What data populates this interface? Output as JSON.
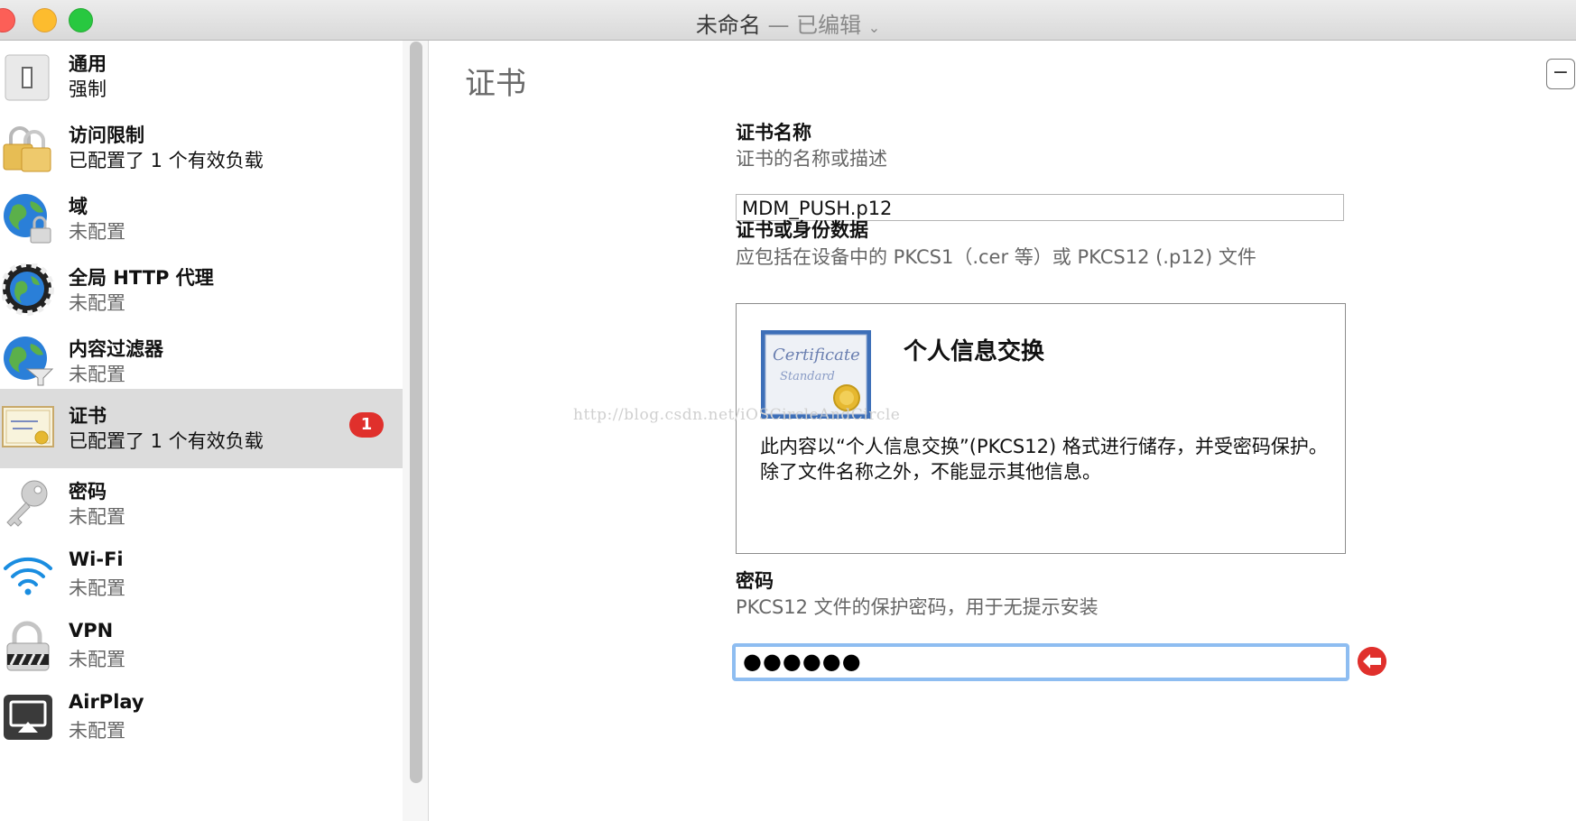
{
  "window": {
    "title": "未命名",
    "subtitle": "— 已编辑"
  },
  "sidebar": {
    "items": [
      {
        "label": "通用",
        "status": "强制",
        "icon": "switch-icon",
        "configured": true
      },
      {
        "label": "访问限制",
        "status": "已配置了 1 个有效负载",
        "icon": "padlocks-icon",
        "configured": true
      },
      {
        "label": "域",
        "status": "未配置",
        "icon": "globe-lock-icon",
        "configured": false
      },
      {
        "label": "全局 HTTP 代理",
        "status": "未配置",
        "icon": "globe-proxy-icon",
        "configured": false
      },
      {
        "label": "内容过滤器",
        "status": "未配置",
        "icon": "globe-filter-icon",
        "configured": false
      },
      {
        "label": "证书",
        "status": "已配置了 1 个有效负载",
        "icon": "certificate-icon",
        "configured": true,
        "selected": true,
        "badge": "1"
      },
      {
        "label": "密码",
        "status": "未配置",
        "icon": "key-icon",
        "configured": false
      },
      {
        "label": "Wi-Fi",
        "status": "未配置",
        "icon": "wifi-icon",
        "configured": false
      },
      {
        "label": "VPN",
        "status": "未配置",
        "icon": "vpn-lock-icon",
        "configured": false
      },
      {
        "label": "AirPlay",
        "status": "未配置",
        "icon": "airplay-icon",
        "configured": false
      }
    ]
  },
  "main": {
    "title": "证书",
    "remove_label": "−",
    "cert_name": {
      "label": "证书名称",
      "description": "证书的名称或描述",
      "value": "MDM_PUSH.p12"
    },
    "cert_data": {
      "label": "证书或身份数据",
      "description": "应包括在设备中的 PKCS1（.cer 等）或 PKCS12 (.p12) 文件",
      "card_title": "个人信息交换",
      "card_description": "此内容以“个人信息交换”(PKCS12) 格式进行储存，并受密码保护。除了文件名称之外，不能显示其他信息。",
      "image_text_1": "Certificate",
      "image_text_2": "Standard"
    },
    "password": {
      "label": "密码",
      "description": "PKCS12 文件的保护密码，用于无提示安装",
      "value": "●●●●●●"
    },
    "watermark": "http://blog.csdn.net/iOSCircleAndCircle"
  },
  "colors": {
    "badge": "#e0302c",
    "focus_ring": "#8ebdf1",
    "selected_row": "#dcdcdc"
  }
}
